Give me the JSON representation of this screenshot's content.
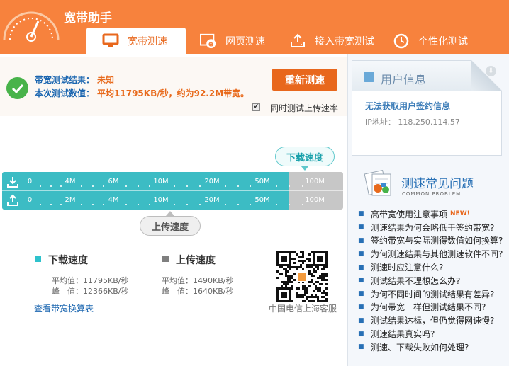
{
  "app": {
    "title": "宽带助手"
  },
  "tabs": [
    {
      "label": "宽带测速",
      "icon": "monitor-icon",
      "active": true
    },
    {
      "label": "网页测速",
      "icon": "ie-browser-icon",
      "active": false
    },
    {
      "label": "接入带宽测试",
      "icon": "upload-tray-icon",
      "active": false
    },
    {
      "label": "个性化测试",
      "icon": "clock-icon",
      "active": false
    }
  ],
  "result": {
    "bandwidth_label": "带宽测试结果：",
    "bandwidth_value": "未知",
    "test_label": "本次测试数值：",
    "test_value": "平均11795KB/秒，约为92.2M带宽。",
    "retest_button": "重新测速",
    "upload_checkbox_label": "同时测试上传速率",
    "upload_checked": true
  },
  "gauge": {
    "download_label": "下载速度",
    "upload_label": "上传速度",
    "download_ticks": [
      "0",
      "4M",
      "6M",
      "10M",
      "20M",
      "50M",
      "100M"
    ],
    "upload_ticks": [
      "0",
      "2M",
      "4M",
      "10M",
      "20M",
      "50M",
      "100M"
    ],
    "fill_fraction": 0.84,
    "colors": {
      "fill": "#3cbcc4",
      "track": "#c7c7c7"
    }
  },
  "stats": {
    "download": {
      "title": "下载速度",
      "avg": "平均值：11795KB/秒",
      "peak": "峰　值：12366KB/秒",
      "color": "#2ec2cc"
    },
    "upload": {
      "title": "上传速度",
      "avg": "平均值：1490KB/秒",
      "peak": "峰　值：1640KB/秒",
      "color": "#7f7f7f"
    },
    "convert_link": "查看带宽换算表"
  },
  "qr": {
    "caption": "中国电信上海客服"
  },
  "user": {
    "title": "用户信息",
    "message": "无法获取用户签约信息",
    "ip": "IP地址： 118.250.114.57"
  },
  "faq": {
    "title": "测速常见问题",
    "subtitle": "COMMON PROBLEM",
    "items": [
      {
        "text": "高带宽使用注意事项",
        "badge": "NEW!"
      },
      {
        "text": "测速结果为何会略低于签约带宽?"
      },
      {
        "text": "签约带宽与实际测得数值如何换算?"
      },
      {
        "text": "为何测速结果与其他测速软件不同?"
      },
      {
        "text": "测速时应注意什么?"
      },
      {
        "text": "测试结果不理想怎么办?"
      },
      {
        "text": "为何不同时间的测试结果有差异?"
      },
      {
        "text": "为何带宽一样但测试结果不同?"
      },
      {
        "text": "测试结果达标，但仍觉得网速慢?"
      },
      {
        "text": "测速结果真实吗?"
      },
      {
        "text": "测速、下载失败如何处理?"
      }
    ]
  },
  "colors": {
    "brand": "#f7823d",
    "accent": "#e8671c",
    "link": "#1b66b0"
  }
}
